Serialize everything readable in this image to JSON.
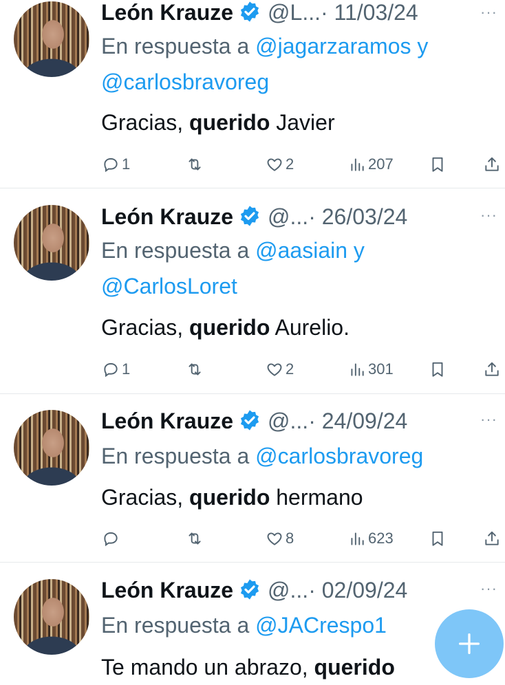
{
  "tweets": [
    {
      "name": "León Krauze",
      "handle": "@L...",
      "date": "· 11/03/24",
      "reply_prefix": "En respuesta a",
      "reply_users": [
        "@jagarzaramos",
        "y",
        "@carlosbravoreg"
      ],
      "body_parts": [
        "Gracias, ",
        "querido",
        " Javier"
      ],
      "replies": "1",
      "retweets": "",
      "likes": "2",
      "views": "207"
    },
    {
      "name": "León Krauze",
      "handle": "@...",
      "date": "· 26/03/24",
      "reply_prefix": "En respuesta a",
      "reply_users": [
        "@aasiain",
        "y",
        "@CarlosLoret"
      ],
      "body_parts": [
        "Gracias, ",
        "querido",
        " Aurelio."
      ],
      "replies": "1",
      "retweets": "",
      "likes": "2",
      "views": "301"
    },
    {
      "name": "León Krauze",
      "handle": "@...",
      "date": "· 24/09/24",
      "reply_prefix": "En respuesta a",
      "reply_users": [
        "@carlosbravoreg"
      ],
      "body_parts": [
        "Gracias, ",
        "querido",
        " hermano"
      ],
      "replies": "",
      "retweets": "",
      "likes": "8",
      "views": "623"
    },
    {
      "name": "León Krauze",
      "handle": "@...",
      "date": "· 02/09/24",
      "reply_prefix": "En respuesta a",
      "reply_users": [
        "@JACrespo1"
      ],
      "body_parts": [
        "Te mando un abrazo, ",
        "querido",
        ""
      ]
    }
  ],
  "more_label": "···",
  "icons": {
    "verified": "verified-badge-icon",
    "reply": "reply-icon",
    "retweet": "retweet-icon",
    "like": "heart-icon",
    "views": "views-icon",
    "bookmark": "bookmark-icon",
    "share": "share-icon",
    "compose": "plus-icon"
  },
  "colors": {
    "link": "#1d9bf0",
    "muted": "#536471",
    "fab": "#7ec6f8"
  }
}
